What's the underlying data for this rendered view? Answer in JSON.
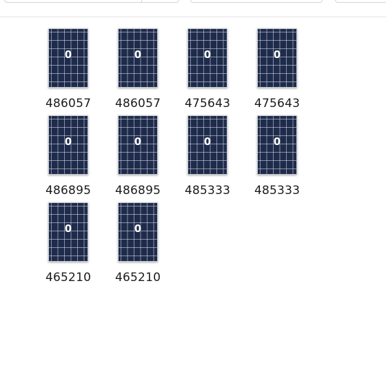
{
  "items": [
    {
      "label": "486057",
      "count": "0"
    },
    {
      "label": "486057",
      "count": "0"
    },
    {
      "label": "475643",
      "count": "0"
    },
    {
      "label": "475643",
      "count": "0"
    },
    {
      "label": "486895",
      "count": "0"
    },
    {
      "label": "486895",
      "count": "0"
    },
    {
      "label": "485333",
      "count": "0"
    },
    {
      "label": "485333",
      "count": "0"
    },
    {
      "label": "465210",
      "count": "0"
    },
    {
      "label": "465210",
      "count": "0"
    }
  ]
}
